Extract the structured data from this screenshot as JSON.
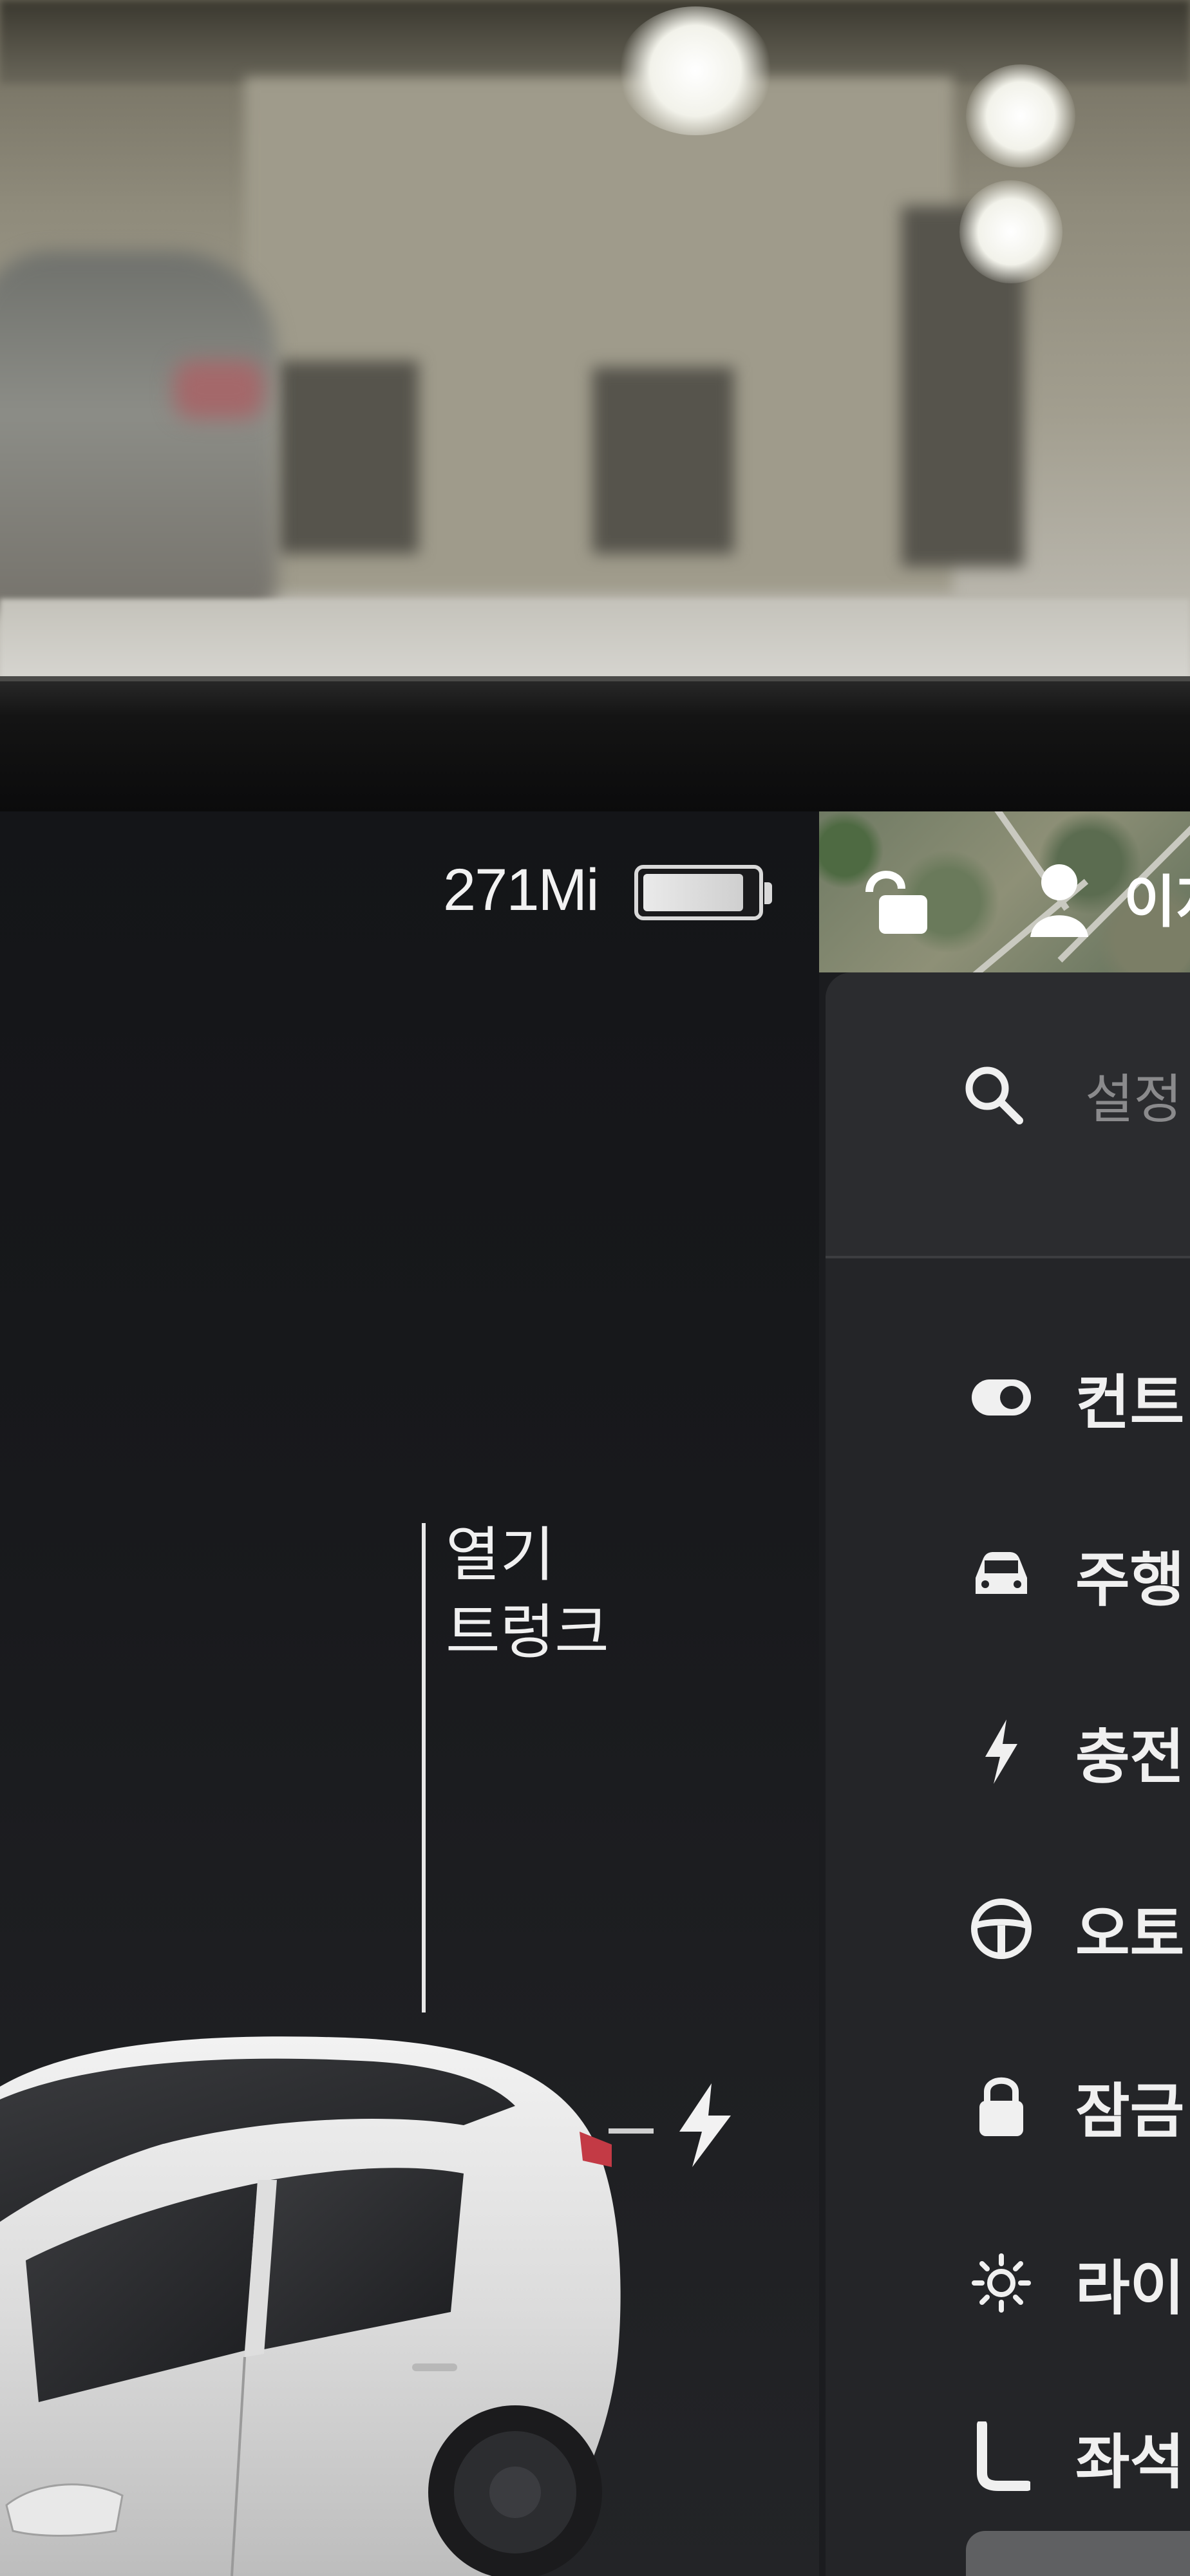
{
  "status_bar": {
    "range": "271Mi",
    "battery_level": 0.9,
    "profile_name": "이지"
  },
  "vehicle_panel": {
    "trunk_label_line1": "열기",
    "trunk_label_line2": "트렁크"
  },
  "settings_panel": {
    "search_placeholder": "설정 l",
    "menu": [
      {
        "label": "컨트",
        "icon": "toggle-icon"
      },
      {
        "label": "주행",
        "icon": "car-icon"
      },
      {
        "label": "충전",
        "icon": "bolt-icon"
      },
      {
        "label": "오토",
        "icon": "steering-wheel-icon"
      },
      {
        "label": "잠금",
        "icon": "lock-icon"
      },
      {
        "label": "라이",
        "icon": "sun-icon"
      },
      {
        "label": "좌석",
        "icon": "seat-icon"
      }
    ]
  },
  "colors": {
    "screen_bg": "#18191c",
    "text": "#f0f0f0",
    "muted_text": "#8a8a8c"
  }
}
